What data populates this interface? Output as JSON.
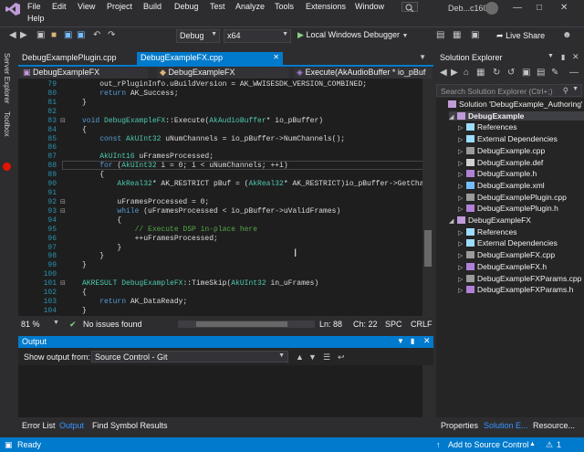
{
  "menu": {
    "items": [
      "File",
      "Edit",
      "View",
      "Project",
      "Build",
      "Debug",
      "Test",
      "Analyze",
      "Tools",
      "Extensions",
      "Window",
      "Help"
    ],
    "window_title": "Deb...c160"
  },
  "toolbar": {
    "config": "Debug",
    "platform": "x64",
    "run_label": "Local Windows Debugger",
    "live_share": "Live Share"
  },
  "side": {
    "server_explorer": "Server Explorer",
    "toolbox": "Toolbox"
  },
  "tabs": [
    {
      "label": "DebugExamplePlugin.cpp"
    },
    {
      "label": "DebugExampleFX.cpp"
    }
  ],
  "nav": {
    "project": "DebugExampleFX",
    "scope": "DebugExampleFX",
    "member": "Execute(AkAudioBuffer * io_pBuf"
  },
  "code": {
    "line_numbers": [
      "79",
      "80",
      "81",
      "82",
      "83",
      "84",
      "85",
      "86",
      "87",
      "88",
      "89",
      "90",
      "91",
      "92",
      "93",
      "94",
      "95",
      "96",
      "97",
      "98",
      "99",
      "100",
      "101",
      "102",
      "103",
      "104",
      "105"
    ],
    "lines": [
      "    out_rPluginInfo.uBuildVersion = AK_WWISESDK_VERSION_COMBINED;",
      "    return AK_Success;",
      "}",
      "",
      "void DebugExampleFX::Execute(AkAudioBuffer* io_pBuffer)",
      "{",
      "    const AkUInt32 uNumChannels = io_pBuffer->NumChannels();",
      "",
      "    AkUInt16 uFramesProcessed;",
      "    for (AkUInt32 i = 0; i < uNumChannels; ++i)",
      "    {",
      "        AkReal32* AK_RESTRICT pBuf = (AkReal32* AK_RESTRICT)io_pBuffer->GetChannel(i);",
      "",
      "        uFramesProcessed = 0;",
      "        while (uFramesProcessed < io_pBuffer->uValidFrames)",
      "        {",
      "            // Execute DSP in-place here",
      "            ++uFramesProcessed;",
      "        }",
      "    }",
      "}",
      "",
      "AKRESULT DebugExampleFX::TimeSkip(AkUInt32 in_uFrames)",
      "{",
      "    return AK_DataReady;",
      "}",
      ""
    ]
  },
  "editor_status": {
    "zoom": "81 %",
    "issues": "No issues found",
    "ln": "Ln: 88",
    "ch": "Ch: 22",
    "spc": "SPC",
    "crlf": "CRLF"
  },
  "output": {
    "title": "Output",
    "show_from_label": "Show output from:",
    "source": "Source Control - Git"
  },
  "bottom_tabs": [
    "Error List",
    "Output",
    "Find Symbol Results"
  ],
  "solution_explorer": {
    "title": "Solution Explorer",
    "search_placeholder": "Search Solution Explorer (Ctrl+;)",
    "items": [
      {
        "label": "Solution 'DebugExample_Authoring'"
      },
      {
        "label": "DebugExample"
      },
      {
        "label": "References"
      },
      {
        "label": "External Dependencies"
      },
      {
        "label": "DebugExample.cpp"
      },
      {
        "label": "DebugExample.def"
      },
      {
        "label": "DebugExample.h"
      },
      {
        "label": "DebugExample.xml"
      },
      {
        "label": "DebugExamplePlugin.cpp"
      },
      {
        "label": "DebugExamplePlugin.h"
      },
      {
        "label": "DebugExampleFX"
      },
      {
        "label": "References"
      },
      {
        "label": "External Dependencies"
      },
      {
        "label": "DebugExampleFX.cpp"
      },
      {
        "label": "DebugExampleFX.h"
      },
      {
        "label": "DebugExampleFXParams.cpp"
      },
      {
        "label": "DebugExampleFXParams.h"
      }
    ],
    "tabs": [
      "Properties",
      "Solution E...",
      "Resource..."
    ]
  },
  "statusbar": {
    "ready": "Ready",
    "add_source": "Add to Source Control",
    "notifications": "1"
  },
  "colors": {
    "accent": "#007acc",
    "editor_bg": "#1e1e1e",
    "keyword": "#569cd6",
    "type": "#4ec9b0",
    "comment": "#57a64a",
    "breakpoint": "#e51400"
  }
}
